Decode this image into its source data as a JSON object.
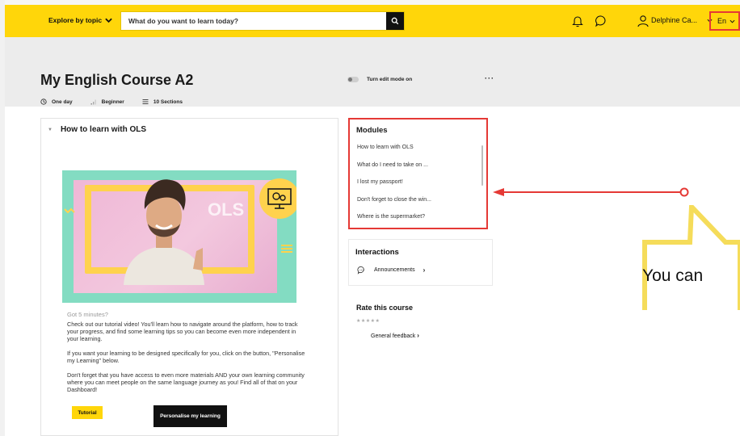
{
  "topbar": {
    "explore_label": "Explore by topic",
    "search_placeholder": "What do you want to learn today?",
    "user_name": "Delphine Ca...",
    "language": "En"
  },
  "course": {
    "title": "My English Course A2",
    "duration": "One day",
    "level": "Beginner",
    "sections": "10 Sections",
    "edit_mode_label": "Turn edit mode on",
    "more_label": "···"
  },
  "section": {
    "title": "How to learn with OLS",
    "video_overlay": "OLS",
    "got5": "Got 5 minutes?",
    "paragraph1": "Check out our tutorial video! You'll learn how to navigate around the platform, how to track your progress, and find some learning tips so you can become even more independent in your learning.",
    "paragraph2": "If you want your learning to be designed specifically for you, click on the button, \"Personalise my Learning\" below.",
    "paragraph3": "Don't forget that you have access to even more materials AND your own learning community where you can meet people on the same language journey as you! Find all of that on your Dashboard!",
    "btn_tutorial": "Tutorial",
    "btn_personalise": "Personalise my learning"
  },
  "modules": {
    "title": "Modules",
    "items": [
      "How to learn with OLS",
      "What do I need to take on ...",
      "I lost my passport!",
      "Don't forget to close the win...",
      "Where is the supermarket?"
    ]
  },
  "interactions": {
    "title": "Interactions",
    "announcements": "Announcements"
  },
  "rate": {
    "title": "Rate this course",
    "stars": "★★★★★",
    "feedback": "General feedback"
  },
  "annotation": {
    "callout_text": "You can"
  },
  "colors": {
    "brand_yellow": "#ffd60a",
    "highlight_red": "#e53935",
    "header_grey": "#ececec",
    "callout_yellow": "#f5dc5a"
  }
}
